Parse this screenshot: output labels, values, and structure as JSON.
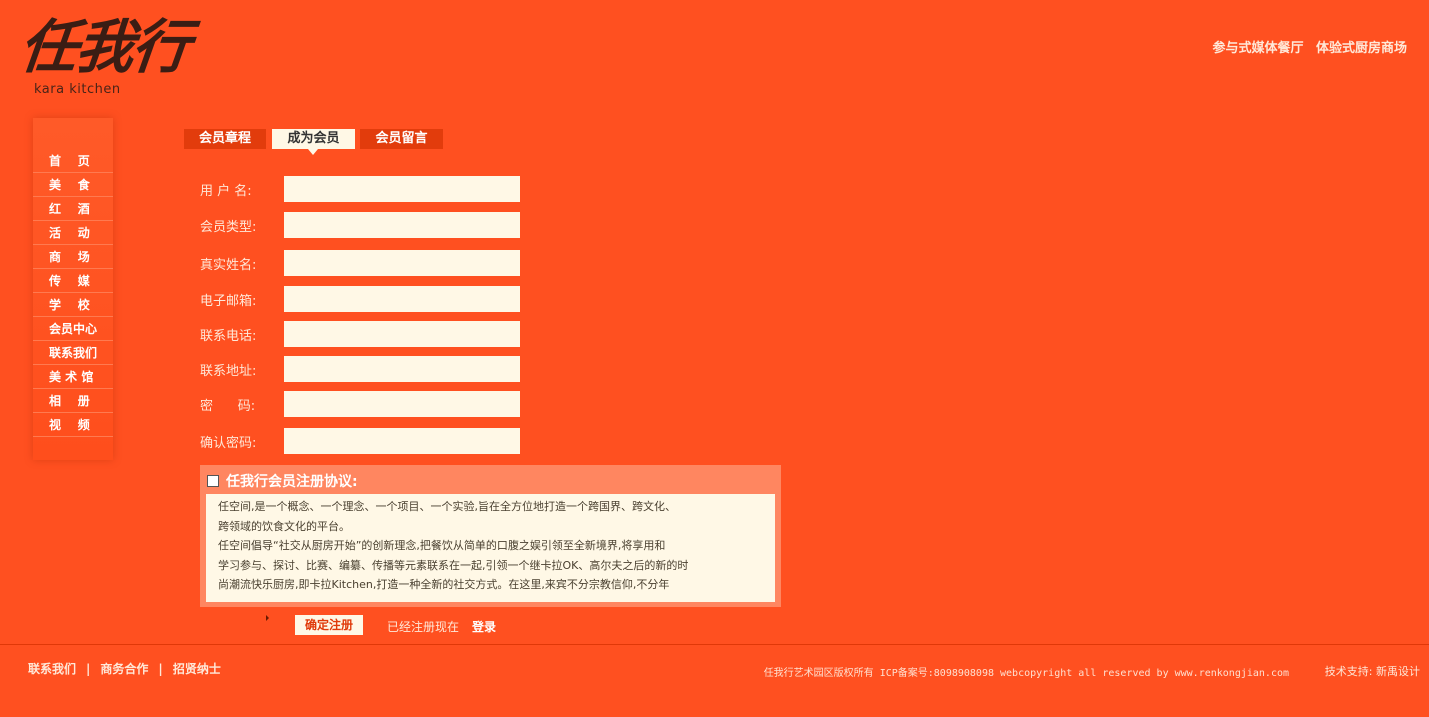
{
  "brand": {
    "logo_title": "任我行",
    "logo_subtitle": "kara kitchen"
  },
  "header": {
    "tagline_1": "参与式媒体餐厅",
    "tagline_2": "体验式厨房商场"
  },
  "sidebar": {
    "items": [
      {
        "label": "首    页"
      },
      {
        "label": "美    食"
      },
      {
        "label": "红    酒"
      },
      {
        "label": "活    动"
      },
      {
        "label": "商    场"
      },
      {
        "label": "传    媒"
      },
      {
        "label": "学    校"
      },
      {
        "label": "会员中心"
      },
      {
        "label": "联系我们"
      },
      {
        "label": "美 术 馆"
      },
      {
        "label": "相    册"
      },
      {
        "label": "视    频"
      }
    ]
  },
  "tabs": [
    {
      "label": "会员章程"
    },
    {
      "label": "成为会员",
      "active": true
    },
    {
      "label": "会员留言"
    }
  ],
  "form": {
    "fields": [
      {
        "label": "用 户 名:",
        "value": ""
      },
      {
        "label": "会员类型:",
        "value": ""
      },
      {
        "label": "真实姓名:",
        "value": ""
      },
      {
        "label": "电子邮箱:",
        "value": ""
      },
      {
        "label": "联系电话:",
        "value": ""
      },
      {
        "label": "联系地址:",
        "value": ""
      },
      {
        "label": "密      码:",
        "value": ""
      },
      {
        "label": "确认密码:",
        "value": ""
      }
    ]
  },
  "agreement": {
    "title": "任我行会员注册协议:",
    "checked": false,
    "lines": [
      "任空间,是一个概念、一个理念、一个项目、一个实验,旨在全方位地打造一个跨国界、跨文化、",
      "跨领域的饮食文化的平台。",
      "任空间倡导“社交从厨房开始”的创新理念,把餐饮从简单的口腹之娱引领至全新境界,将享用和",
      "学习参与、探讨、比赛、编纂、传播等元素联系在一起,引领一个继卡拉OK、高尔夫之后的新的时",
      "尚潮流快乐厨房,即卡拉Kitchen,打造一种全新的社交方式。在这里,来宾不分宗教信仰,不分年"
    ]
  },
  "actions": {
    "submit_label": "确定注册",
    "registered_text": "已经注册现在",
    "login_label": "登录"
  },
  "footer": {
    "links": [
      {
        "label": "联系我们"
      },
      {
        "label": "商务合作"
      },
      {
        "label": "招贤纳士"
      }
    ],
    "separator": "|",
    "copyright": "任我行艺术园区版权所有 ICP备案号:8098908098 webcopyright all reserved by www.renkongjian.com",
    "tech_support": "技术支持: 新禹设计"
  },
  "colors": {
    "background": "#ff5020",
    "input_bg": "#fff8e6",
    "tab_inactive": "#e23c0c",
    "agreement_frame": "#ff8660"
  }
}
